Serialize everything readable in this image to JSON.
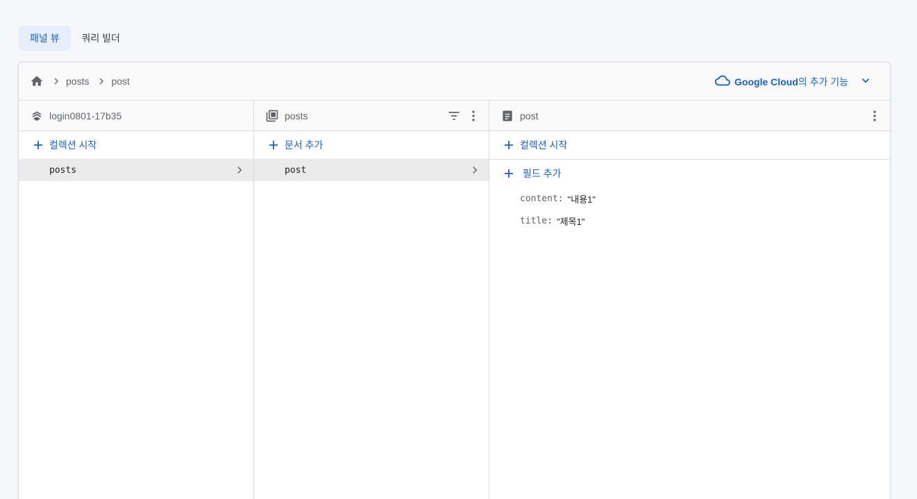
{
  "tabs": [
    {
      "label": "패널 뷰",
      "active": true
    },
    {
      "label": "쿼리 빌더",
      "active": false
    }
  ],
  "breadcrumb": {
    "home_icon": "home-icon",
    "items": [
      "posts",
      "post"
    ]
  },
  "google_cloud": {
    "brand": "Google Cloud",
    "suffix": "의 추가 기능",
    "icon": "cloud-icon"
  },
  "columns": {
    "project": {
      "title": "login0801-17b35",
      "icon": "firestore-icon",
      "add_label": "컬렉션 시작",
      "items": [
        "posts"
      ]
    },
    "collection": {
      "title": "posts",
      "icon": "collection-icon",
      "add_label": "문서 추가",
      "items": [
        "post"
      ]
    },
    "document": {
      "title": "post",
      "icon": "document-icon",
      "add_collection_label": "컬렉션 시작",
      "add_field_label": "필드 추가",
      "fields": [
        {
          "key": "content:",
          "value": "\"내용1\""
        },
        {
          "key": "title:",
          "value": "\"제목1\""
        }
      ]
    }
  },
  "colors": {
    "accent": "#1a5fc4",
    "selected_row": "#ebebeb",
    "active_tab_bg": "#e6eefb"
  }
}
